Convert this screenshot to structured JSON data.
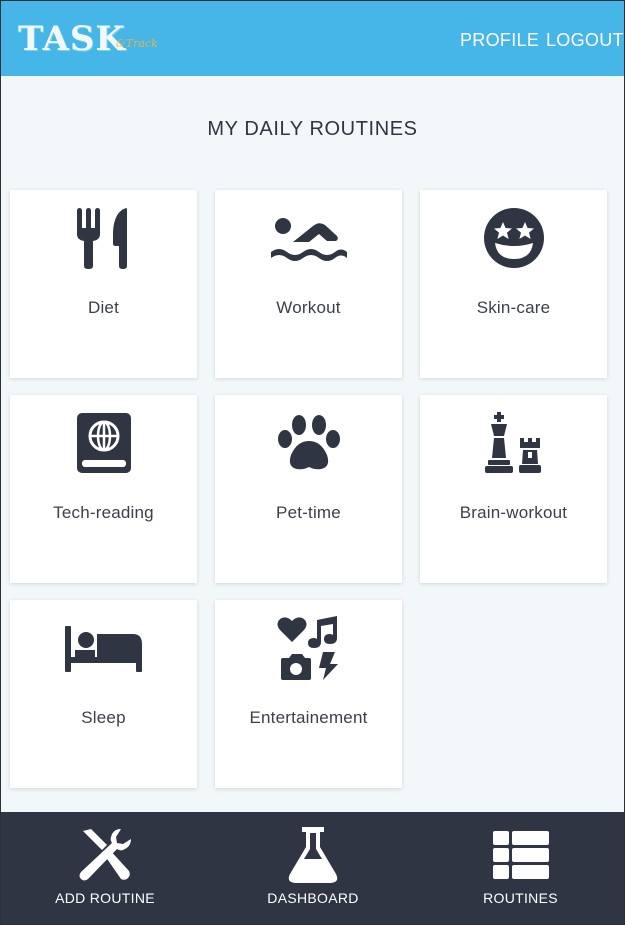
{
  "header": {
    "logo_main": "TASK",
    "logo_sub": "&Track",
    "profile_label": "PROFILE",
    "logout_label": "LOGOUT"
  },
  "page_title": "MY DAILY ROUTINES",
  "routines": [
    {
      "label": "Diet",
      "icon": "utensils-icon"
    },
    {
      "label": "Workout",
      "icon": "swimmer-icon"
    },
    {
      "label": "Skin-care",
      "icon": "grin-stars-icon"
    },
    {
      "label": "Tech-reading",
      "icon": "globe-book-icon"
    },
    {
      "label": "Pet-time",
      "icon": "paw-icon"
    },
    {
      "label": "Brain-workout",
      "icon": "chess-icon"
    },
    {
      "label": "Sleep",
      "icon": "bed-icon"
    },
    {
      "label": "Entertainement",
      "icon": "icons-icon"
    }
  ],
  "bottom_nav": {
    "add_routine_label": "ADD ROUTINE",
    "dashboard_label": "DASHBOARD",
    "routines_label": "ROUTINES"
  },
  "colors": {
    "header_bg": "#45b6e7",
    "page_bg": "#f2f8f9",
    "icon_dark": "#2f3542",
    "bottom_nav_bg": "#2f3542",
    "logo_accent": "#e6b44a"
  }
}
